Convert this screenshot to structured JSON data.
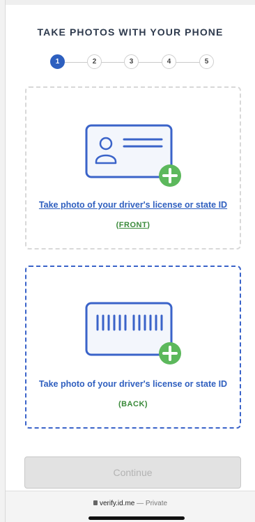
{
  "header": {
    "title": "TAKE PHOTOS WITH YOUR PHONE"
  },
  "stepper": {
    "steps": [
      "1",
      "2",
      "3",
      "4",
      "5"
    ],
    "active": 1
  },
  "front_card": {
    "label": "Take photo of your driver's license or state ID",
    "side": "FRONT",
    "icon": "id-card-icon"
  },
  "back_card": {
    "label": "Take photo of your driver's license or state ID",
    "side": "BACK",
    "icon": "barcode-card-icon"
  },
  "continue_button": {
    "label": "Continue"
  },
  "browser_bar": {
    "domain": "verify.id.me",
    "separator": "—",
    "mode": "Private"
  },
  "colors": {
    "accent": "#2f5fbf",
    "add_badge": "#5cb85c",
    "side_text": "#3a8a3a",
    "border_inactive": "#d8d8d8",
    "border_active": "#3a63c9"
  }
}
